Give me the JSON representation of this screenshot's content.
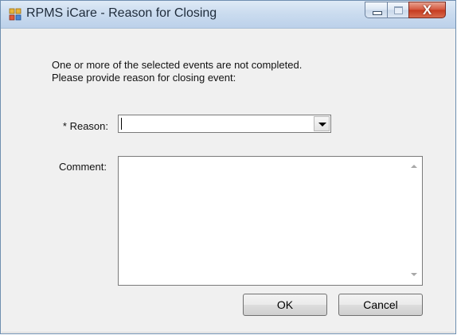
{
  "window": {
    "title": "RPMS iCare - Reason for Closing",
    "app_icon": "windows-forms-app-icon",
    "controls": {
      "minimize_icon": "minimize-icon",
      "maximize_icon": "maximize-icon",
      "close_glyph": "X"
    }
  },
  "dialog": {
    "message_line1": "One or more of the selected events are not completed.",
    "message_line2": "Please provide reason for closing event:",
    "reason_label": "* Reason:",
    "reason_value": "",
    "comment_label": "Comment:",
    "comment_value": "",
    "ok_label": "OK",
    "cancel_label": "Cancel"
  },
  "colors": {
    "titlebar": "#cbdcef",
    "close_button": "#c53a1f",
    "dialog_background": "#f0f0f0"
  }
}
